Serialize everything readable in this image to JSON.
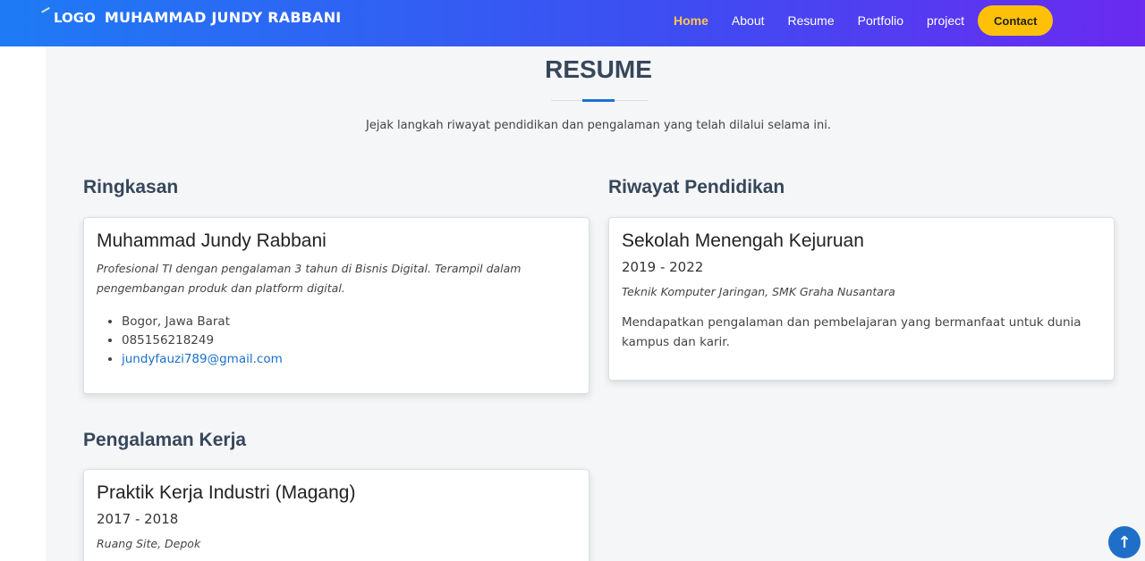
{
  "header": {
    "logo_text": "LOGO",
    "site_name": "MUHAMMAD JUNDY RABBANI",
    "nav": [
      {
        "label": "Home",
        "active": true
      },
      {
        "label": "About"
      },
      {
        "label": "Resume"
      },
      {
        "label": "Portfolio"
      },
      {
        "label": "project"
      }
    ],
    "contact_label": "Contact",
    "accent_color": "#ffc451",
    "button_color": "#ffc107"
  },
  "resume": {
    "title": "RESUME",
    "subtitle": "Jejak langkah riwayat pendidikan dan pengalaman yang telah dilalui selama ini.",
    "summary": {
      "heading": "Ringkasan",
      "name": "Muhammad Jundy Rabbani",
      "bio_line1": "Profesional TI dengan pengalaman 3 tahun di Bisnis Digital. Terampil dalam",
      "bio_line2": "pengembangan produk dan platform digital.",
      "location": "Bogor, Jawa Barat",
      "phone": "085156218249",
      "email": "jundyfauzi789@gmail.com"
    },
    "education": {
      "heading": "Riwayat Pendidikan",
      "school": "Sekolah Menengah Kejuruan",
      "period": "2019 - 2022",
      "major": "Teknik Komputer Jaringan, SMK Graha Nusantara",
      "desc_line1": "Mendapatkan pengalaman dan pembelajaran yang bermanfaat untuk dunia",
      "desc_line2": "kampus dan karir."
    },
    "experience": {
      "heading": "Pengalaman Kerja",
      "role": "Praktik Kerja Industri (Magang)",
      "period": "2017 - 2018",
      "company": "Ruang Site, Depok"
    }
  },
  "back_to_top_icon": "arrow-up-icon"
}
